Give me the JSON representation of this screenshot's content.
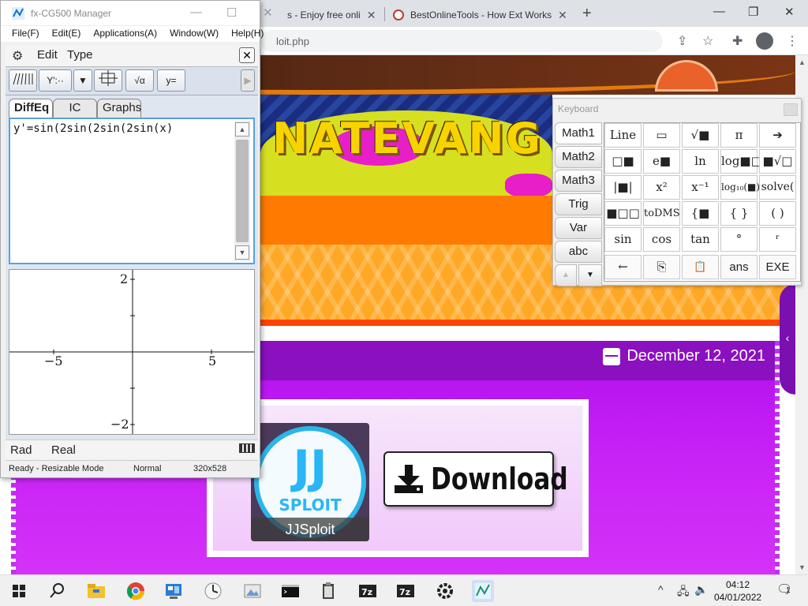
{
  "browser": {
    "tabs": [
      {
        "title": "s - Enjoy free onli"
      },
      {
        "title": "BestOnlineTools - How Ext Works"
      }
    ],
    "new_tab": "+",
    "win_min": "—",
    "win_restore": "❐",
    "win_close": "✕",
    "url": "loit.php"
  },
  "page": {
    "brand": "NATEVANG",
    "date": "December 12, 2021",
    "jj_big": "JJ",
    "jj_small": "SPLOIT",
    "jj_caption": "JJSploit",
    "download": "Download",
    "side_chevron": "‹"
  },
  "fx": {
    "title": "fx-CG500 Manager",
    "menu": [
      "File(F)",
      "Edit(E)",
      "Applications(A)",
      "Window(W)",
      "Help(H)"
    ],
    "ms_edit": "Edit",
    "ms_type": "Type",
    "toolbar": {
      "yprime": "Y':··",
      "sqrt": "√α",
      "yeq": "y="
    },
    "tabs": [
      "DiffEq",
      "IC",
      "Graphs"
    ],
    "equation": "y'=sin(2sin(2sin(2sin(x)",
    "graph": {
      "ymax": "2",
      "ymin": "−2",
      "xmin": "−5",
      "xmax": "5"
    },
    "status": {
      "angle": "Rad",
      "mode": "Real"
    },
    "footer": {
      "ready": "Ready - Resizable Mode",
      "normal": "Normal",
      "size": "320x528"
    }
  },
  "keyboard": {
    "title": "Keyboard",
    "side": [
      "Math1",
      "Math2",
      "Math3",
      "Trig",
      "Var",
      "abc"
    ],
    "keys": [
      [
        "Line",
        "▭",
        "√■",
        "π",
        "➔"
      ],
      [
        "□■",
        "e■",
        "ln",
        "log■□",
        "■√□"
      ],
      [
        "|■|",
        "x²",
        "x⁻¹",
        "log₁₀(■)",
        "solve("
      ],
      [
        "■□□",
        "toDMS",
        "{■",
        "{ }",
        "( )"
      ],
      [
        "sin",
        "cos",
        "tan",
        "°",
        "ʳ"
      ],
      [
        "←",
        "⎘",
        "📋",
        "ans",
        "EXE"
      ]
    ]
  },
  "taskbar": {
    "time": "04:12",
    "date": "04/01/2022",
    "notif": "1"
  }
}
